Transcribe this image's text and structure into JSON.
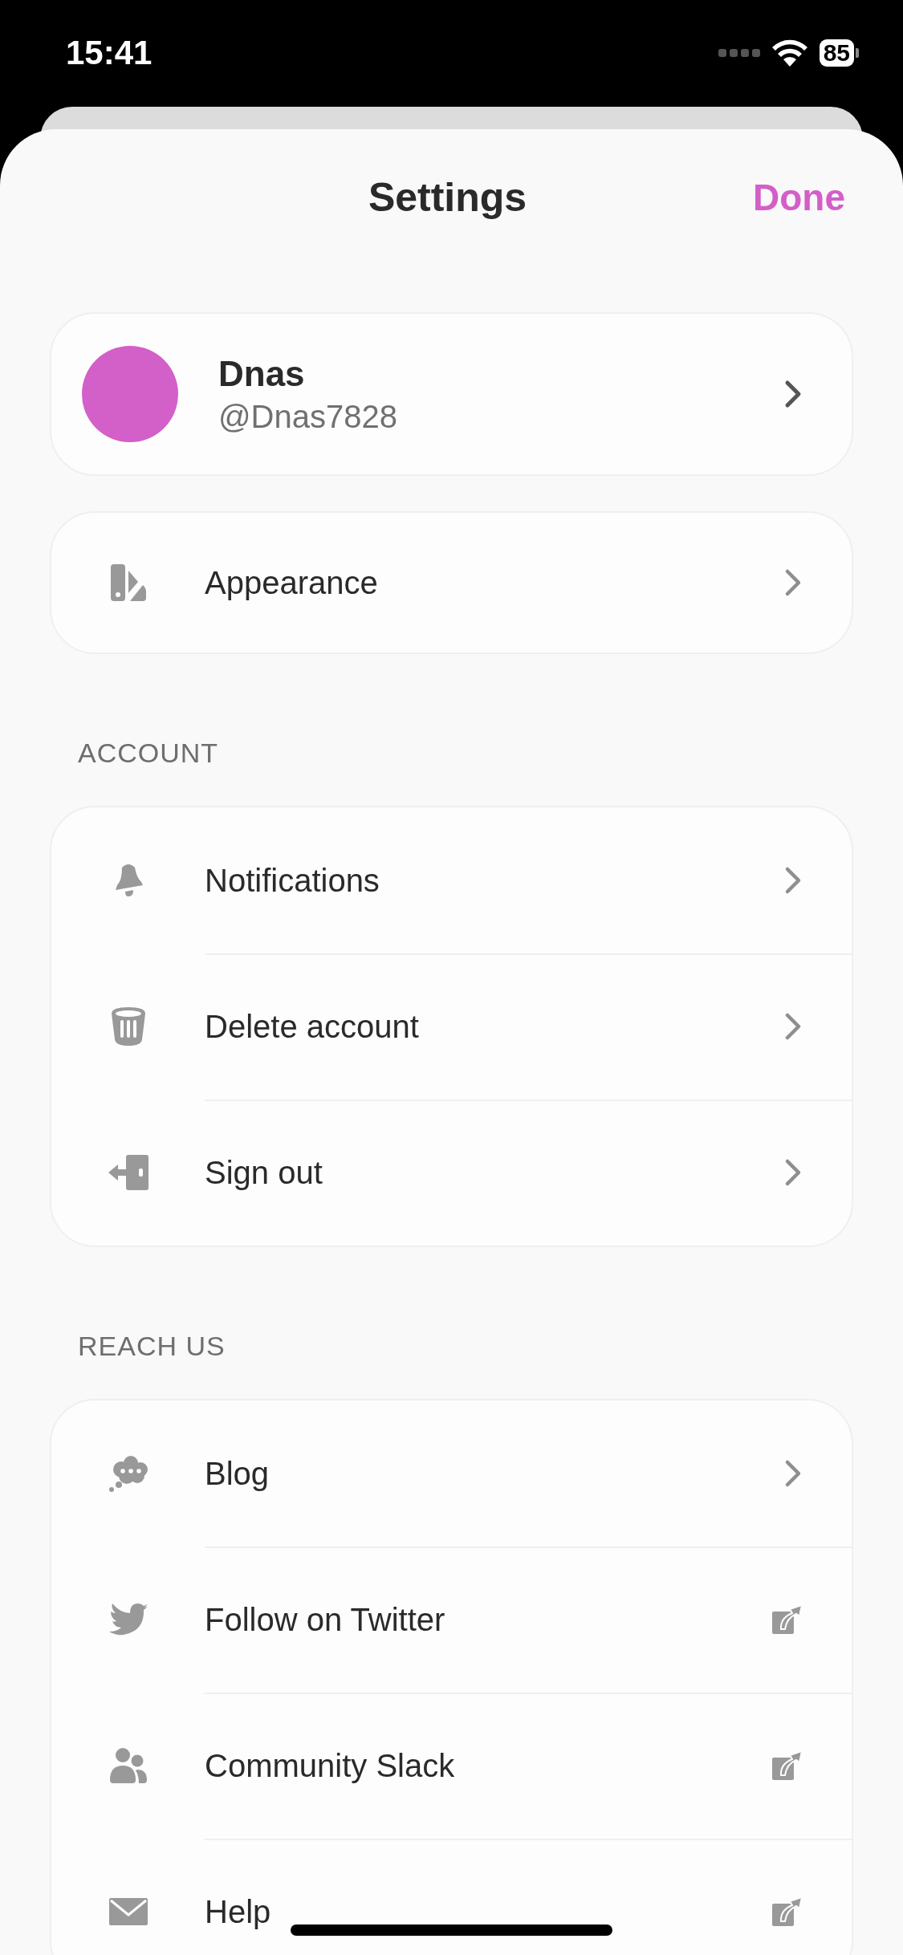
{
  "status_bar": {
    "time": "15:41",
    "battery": "85"
  },
  "header": {
    "title": "Settings",
    "done": "Done"
  },
  "profile": {
    "name": "Dnas",
    "handle": "@Dnas7828",
    "color": "#d35fc8"
  },
  "top_items": [
    {
      "label": "Appearance",
      "kind": "chevron"
    }
  ],
  "sections": [
    {
      "title": "ACCOUNT",
      "items": [
        {
          "label": "Notifications",
          "kind": "chevron"
        },
        {
          "label": "Delete account",
          "kind": "chevron"
        },
        {
          "label": "Sign out",
          "kind": "chevron"
        }
      ]
    },
    {
      "title": "REACH US",
      "items": [
        {
          "label": "Blog",
          "kind": "chevron"
        },
        {
          "label": "Follow on Twitter",
          "kind": "external"
        },
        {
          "label": "Community Slack",
          "kind": "external"
        },
        {
          "label": "Help",
          "kind": "external"
        }
      ]
    }
  ]
}
